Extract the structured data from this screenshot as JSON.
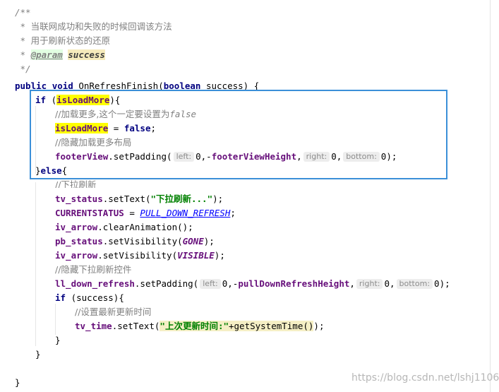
{
  "doc": {
    "c_open": "/**",
    "c1": "当联网成功和失败的时候回调该方法",
    "c2": "用于刷新状态的还原",
    "c_param_tag": "@param",
    "c_param_val": "success",
    "c_close": "*/",
    "star": "*"
  },
  "sig": {
    "kw_public": "public",
    "kw_void": "void",
    "name": "OnRefreshFinish(",
    "kw_boolean": "boolean",
    "rest": "success) {"
  },
  "ifblock": {
    "kw_if": "if",
    "paren": " (",
    "cond": "isLoadMore",
    "close": "){",
    "comment1": "//加载更多,这个一定要设置为",
    "comment1_false": "false",
    "assign_var": "isLoadMore",
    "assign_op": " = ",
    "kw_false": "false",
    "semi": ";",
    "comment2": "//隐藏加载更多布局",
    "footer_obj": "footerView",
    "footer_call": ".setPadding(",
    "hint_left": "left:",
    "hint_right": "right:",
    "hint_bottom": "bottom:",
    "zero_comma": "0,",
    "minus": "-",
    "footer_height": "footerViewHeight",
    "comma": ",",
    "zero": "0",
    "end_call": ");"
  },
  "elseblock": {
    "close_else": "}",
    "kw_else": "else",
    "open": "{",
    "comment_pull": "//下拉刷新",
    "tv_status": "tv_status",
    "settext_open": ".setText(",
    "str_pull": "\"下拉刷新...\"",
    "end_call": ");",
    "currentstatus": "CURRENTSTATUS",
    "eq": " = ",
    "pull_down": "PULL_DOWN_REFRESH",
    "semi": ";",
    "iv_arrow": "iv_arrow",
    "clear_anim": ".clearAnimation();",
    "pb_status": "pb_status",
    "set_vis": ".setVisibility(",
    "gone": "GONE",
    "visible": "VISIBLE",
    "comment_hide": "//隐藏下拉刷新控件",
    "ll_down": "ll_down_refresh",
    "set_padding": ".setPadding(",
    "pull_height": "pullDownRefreshHeight",
    "kw_if": "if",
    "success_cond": " (success){",
    "comment_time": "//设置最新更新时间",
    "tv_time": "tv_time",
    "str_time": "\"上次更新时间:\"",
    "plus_call": "+getSystemTime()",
    "brace": "}",
    "brace_inner": "}"
  },
  "final_brace": "}",
  "watermark": "https://blog.csdn.net/lshj1106"
}
